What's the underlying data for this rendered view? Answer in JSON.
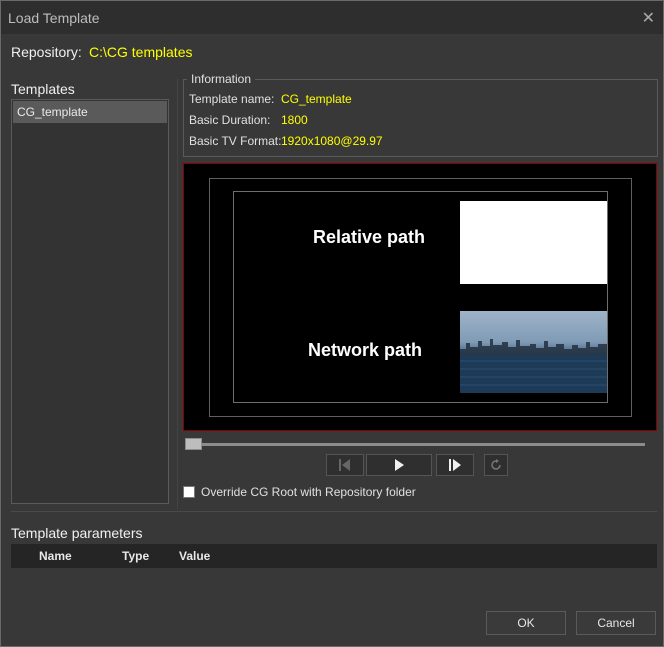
{
  "window": {
    "title": "Load Template",
    "close_icon": "close-icon"
  },
  "repository": {
    "label": "Repository:",
    "value": "C:\\CG templates"
  },
  "templates": {
    "title": "Templates",
    "items": [
      "CG_template"
    ]
  },
  "information": {
    "legend": "Information",
    "template_name_label": "Template name:",
    "template_name_value": "CG_template",
    "basic_duration_label": "Basic Duration:",
    "basic_duration_value": "1800",
    "basic_tv_format_label": "Basic TV Format:",
    "basic_tv_format_value": "1920x1080@29.97"
  },
  "preview": {
    "relative_label": "Relative path",
    "network_label": "Network path"
  },
  "playback": {
    "position": 0,
    "icons": [
      "step-back-icon",
      "play-icon",
      "step-forward-icon",
      "loop-icon"
    ]
  },
  "override": {
    "label": "Override CG Root with Repository folder",
    "checked": false
  },
  "parameters": {
    "title": "Template parameters",
    "columns": [
      "Name",
      "Type",
      "Value"
    ]
  },
  "buttons": {
    "ok": "OK",
    "cancel": "Cancel"
  },
  "colors": {
    "accent": "#ffff00",
    "preview_border": "#8a0000"
  }
}
